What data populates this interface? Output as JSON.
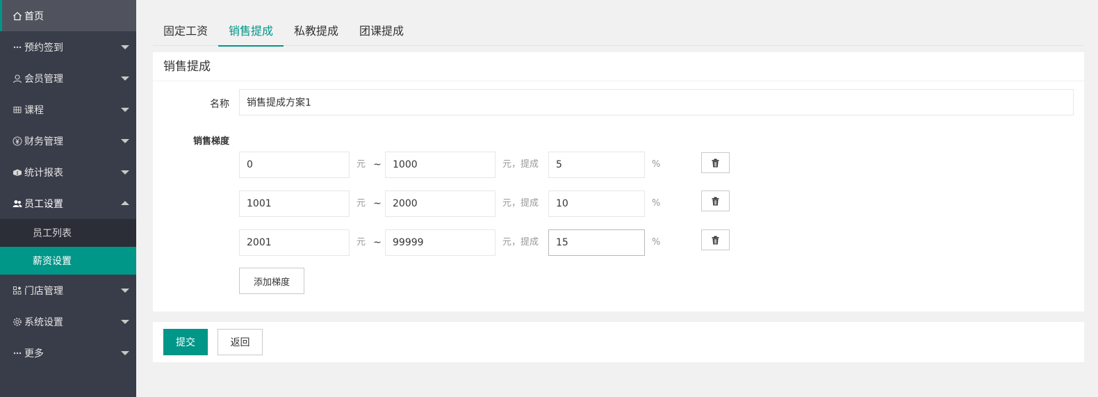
{
  "sidebar": {
    "items": [
      {
        "label": "首页",
        "icon": "home-icon"
      },
      {
        "label": "预约签到",
        "icon": "more-dots-icon"
      },
      {
        "label": "会员管理",
        "icon": "user-icon"
      },
      {
        "label": "课程",
        "icon": "grid-icon"
      },
      {
        "label": "财务管理",
        "icon": "yen-icon"
      },
      {
        "label": "统计报表",
        "icon": "chart-icon"
      },
      {
        "label": "员工设置",
        "icon": "users-icon"
      },
      {
        "label": "门店管理",
        "icon": "store-icon"
      },
      {
        "label": "系统设置",
        "icon": "gear-icon"
      },
      {
        "label": "更多",
        "icon": "more-dots-icon"
      }
    ],
    "sub_items": [
      {
        "label": "员工列表"
      },
      {
        "label": "薪资设置"
      }
    ]
  },
  "tabs": [
    {
      "label": "固定工资"
    },
    {
      "label": "销售提成"
    },
    {
      "label": "私教提成"
    },
    {
      "label": "团课提成"
    }
  ],
  "form": {
    "title": "销售提成",
    "name_label": "名称",
    "name_value": "销售提成方案1",
    "tier_label": "销售梯度",
    "unit_yuan": "元",
    "tilde": "~",
    "unit_yuan_commission": "元，提成",
    "percent": "%",
    "tiers": [
      {
        "from": "0",
        "to": "1000",
        "rate": "5"
      },
      {
        "from": "1001",
        "to": "2000",
        "rate": "10"
      },
      {
        "from": "2001",
        "to": "99999",
        "rate": "15"
      }
    ],
    "add_tier_label": "添加梯度"
  },
  "actions": {
    "submit_label": "提交",
    "back_label": "返回"
  },
  "colors": {
    "accent": "#009688",
    "sidebar_bg": "#393d49"
  }
}
